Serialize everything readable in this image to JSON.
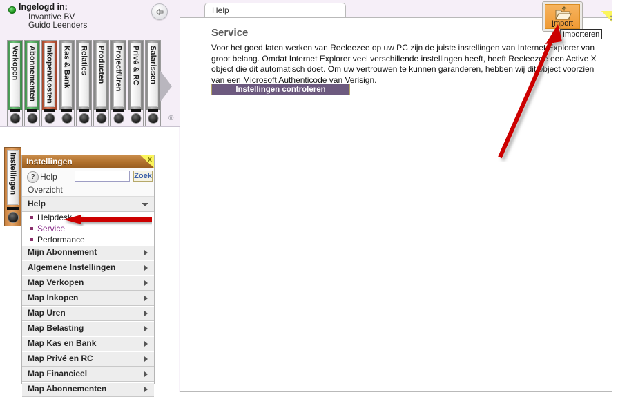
{
  "login": {
    "status_icon": "green-status-dot",
    "title": "Ingelogd in:",
    "company": "Invantive BV",
    "user": "Guido  Leenders",
    "back_icon": "back-arrow-icon"
  },
  "shelf": {
    "binders": [
      {
        "label": "Verkopen",
        "color": "#4a9c56"
      },
      {
        "label": "Abonnementen",
        "color": "#4a9c56"
      },
      {
        "label": "Inkopen/Kosten",
        "color": "#bb5334"
      },
      {
        "label": "Kas & Bank",
        "color": "#8f8f8f"
      },
      {
        "label": "Relaties",
        "color": "#8f8f8f"
      },
      {
        "label": "Producten",
        "color": "#8f8f8f"
      },
      {
        "label": "Project/Uren",
        "color": "#8f8f8f"
      },
      {
        "label": "Privé & RC",
        "color": "#8f8f8f"
      },
      {
        "label": "Salarissen",
        "color": "#8f8f8f"
      }
    ],
    "next_icon": "next-arrow-icon",
    "registered_mark": "®"
  },
  "settings_tab": {
    "label": "Instellingen",
    "color": "#c9813f"
  },
  "settings_panel": {
    "title": "Instellingen",
    "close_icon": "close-icon",
    "close_glyph": "x",
    "help_icon": "question-mark-icon",
    "help_glyph": "?",
    "help_label": "Help",
    "search_value": "",
    "search_placeholder": "",
    "search_button": "Zoek",
    "overview_label": "Overzicht",
    "sections": [
      {
        "label": "Help",
        "expanded": true,
        "items": [
          {
            "label": "Helpdesk",
            "active": false
          },
          {
            "label": "Service",
            "active": true
          },
          {
            "label": "Performance",
            "active": false
          }
        ]
      },
      {
        "label": "Mijn Abonnement",
        "expanded": false,
        "items": []
      },
      {
        "label": "Algemene Instellingen",
        "expanded": false,
        "items": []
      },
      {
        "label": "Map Verkopen",
        "expanded": false,
        "items": []
      },
      {
        "label": "Map Inkopen",
        "expanded": false,
        "items": []
      },
      {
        "label": "Map Uren",
        "expanded": false,
        "items": []
      },
      {
        "label": "Map Belasting",
        "expanded": false,
        "items": []
      },
      {
        "label": "Map Kas en Bank",
        "expanded": false,
        "items": []
      },
      {
        "label": "Map Privé en RC",
        "expanded": false,
        "items": []
      },
      {
        "label": "Map Financieel",
        "expanded": false,
        "items": []
      },
      {
        "label": "Map Abonnementen",
        "expanded": false,
        "items": []
      }
    ]
  },
  "content": {
    "tab_label": "Help",
    "title": "Service",
    "paragraph": "Voor het goed laten werken van Reeleezee op uw PC zijn de juiste instellingen van Internet Explorer van groot belang. Omdat Internet Explorer veel verschillende instellingen heeft, heeft Reeleezee een Active X object die dit automatisch doet. Om uw vertrouwen te kunnen garanderen, hebben wij dit object voorzien van een Microsoft Authenticode van Verisign.",
    "check_button": "Instellingen controleren",
    "check_button_color": "#6d5a7f"
  },
  "toolbar": {
    "import_icon": "folder-import-icon",
    "import_label_accel": "I",
    "import_label_rest": "mport",
    "import_tooltip": "Importeren",
    "import_color": "#ef9a34",
    "close_icon": "close-icon",
    "close_glyph": "×"
  },
  "annotations": [
    {
      "name": "arrow-to-service",
      "color": "#cc0000",
      "direction": "left"
    },
    {
      "name": "arrow-to-import",
      "color": "#cc0000",
      "direction": "up-right"
    }
  ]
}
